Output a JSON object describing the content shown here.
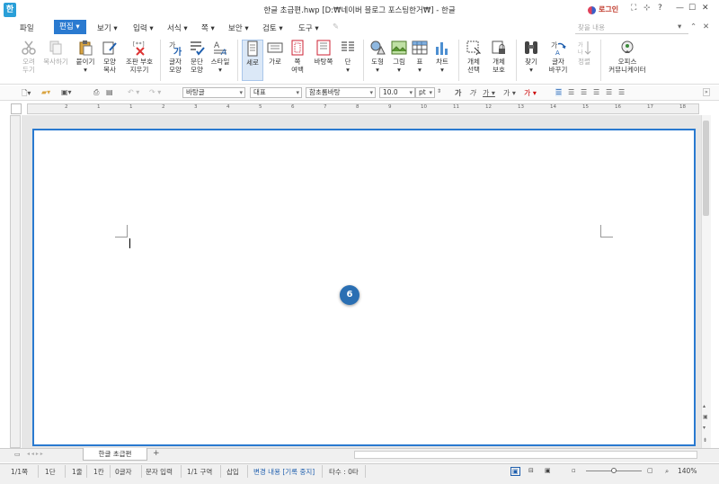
{
  "window": {
    "app_icon": "한",
    "title": "한글 초급편.hwp [D:₩네이버 블로그 포스팅한거₩] - 한글",
    "login": "로그인",
    "controls": [
      "⛶",
      "⊹",
      "?",
      "—",
      "☐",
      "✕"
    ]
  },
  "menu": {
    "items": [
      "파일",
      "편집",
      "보기",
      "입력",
      "서식",
      "쪽",
      "보안",
      "검토",
      "도구"
    ],
    "search_placeholder": "찾을 내용"
  },
  "ribbon": {
    "buttons": [
      {
        "label1": "오려",
        "label2": "두기",
        "icon": "scissors-icon"
      },
      {
        "label1": "복사하기",
        "label2": "",
        "icon": "copy-icon"
      },
      {
        "label1": "붙이기",
        "label2": "",
        "icon": "paste-icon"
      },
      {
        "label1": "모양",
        "label2": "복사",
        "icon": "format-copy-icon"
      },
      {
        "label1": "조판 부호",
        "label2": "지우기",
        "icon": "clear-markup-icon"
      },
      {
        "label1": "글자",
        "label2": "모양",
        "icon": "char-shape-icon"
      },
      {
        "label1": "문단",
        "label2": "모양",
        "icon": "paragraph-shape-icon"
      },
      {
        "label1": "스타일",
        "label2": "",
        "icon": "style-icon"
      },
      {
        "label1": "세로",
        "label2": "",
        "icon": "portrait-icon"
      },
      {
        "label1": "가로",
        "label2": "",
        "icon": "landscape-icon"
      },
      {
        "label1": "쪽",
        "label2": "여백",
        "icon": "page-margin-icon"
      },
      {
        "label1": "바탕쪽",
        "label2": "",
        "icon": "master-page-icon"
      },
      {
        "label1": "단",
        "label2": "",
        "icon": "columns-icon"
      },
      {
        "label1": "도형",
        "label2": "",
        "icon": "shapes-icon"
      },
      {
        "label1": "그림",
        "label2": "",
        "icon": "picture-icon"
      },
      {
        "label1": "표",
        "label2": "",
        "icon": "table-icon"
      },
      {
        "label1": "차트",
        "label2": "",
        "icon": "chart-icon"
      },
      {
        "label1": "개체",
        "label2": "선택",
        "icon": "object-select-icon"
      },
      {
        "label1": "개체",
        "label2": "보호",
        "icon": "object-protect-icon"
      },
      {
        "label1": "찾기",
        "label2": "",
        "icon": "binoculars-icon"
      },
      {
        "label1": "글자",
        "label2": "바꾸기",
        "icon": "replace-icon"
      },
      {
        "label1": "정렬",
        "label2": "",
        "icon": "sort-icon"
      },
      {
        "label1": "오피스",
        "label2": "커뮤니케이터",
        "icon": "communicator-icon"
      }
    ]
  },
  "toolbar2": {
    "style": "바탕글",
    "language": "대표",
    "font": "함초롬바탕",
    "size": "10.0",
    "unit": "pt"
  },
  "ruler": {
    "numbers": [
      "2",
      "1",
      "1",
      "2",
      "3",
      "4",
      "5",
      "6",
      "7",
      "8",
      "9",
      "10",
      "11",
      "12",
      "13",
      "14",
      "15",
      "16",
      "17",
      "18"
    ]
  },
  "document": {
    "badge": "6"
  },
  "tabs": {
    "doc_tab": "한글 초급편",
    "add": "+"
  },
  "status": {
    "page": "1/1쪽",
    "section": "1단",
    "line": "1줄",
    "column": "1칸",
    "chars": "0글자",
    "input_mode": "문자 입력",
    "area": "1/1 구역",
    "insert": "삽입",
    "change": "변경 내용 [기록 중지]",
    "typing": "타수 : 0타",
    "zoom": "140%"
  },
  "colors": {
    "accent": "#2a7ad0",
    "badge": "#2a6fb3",
    "login": "#c0392b"
  }
}
